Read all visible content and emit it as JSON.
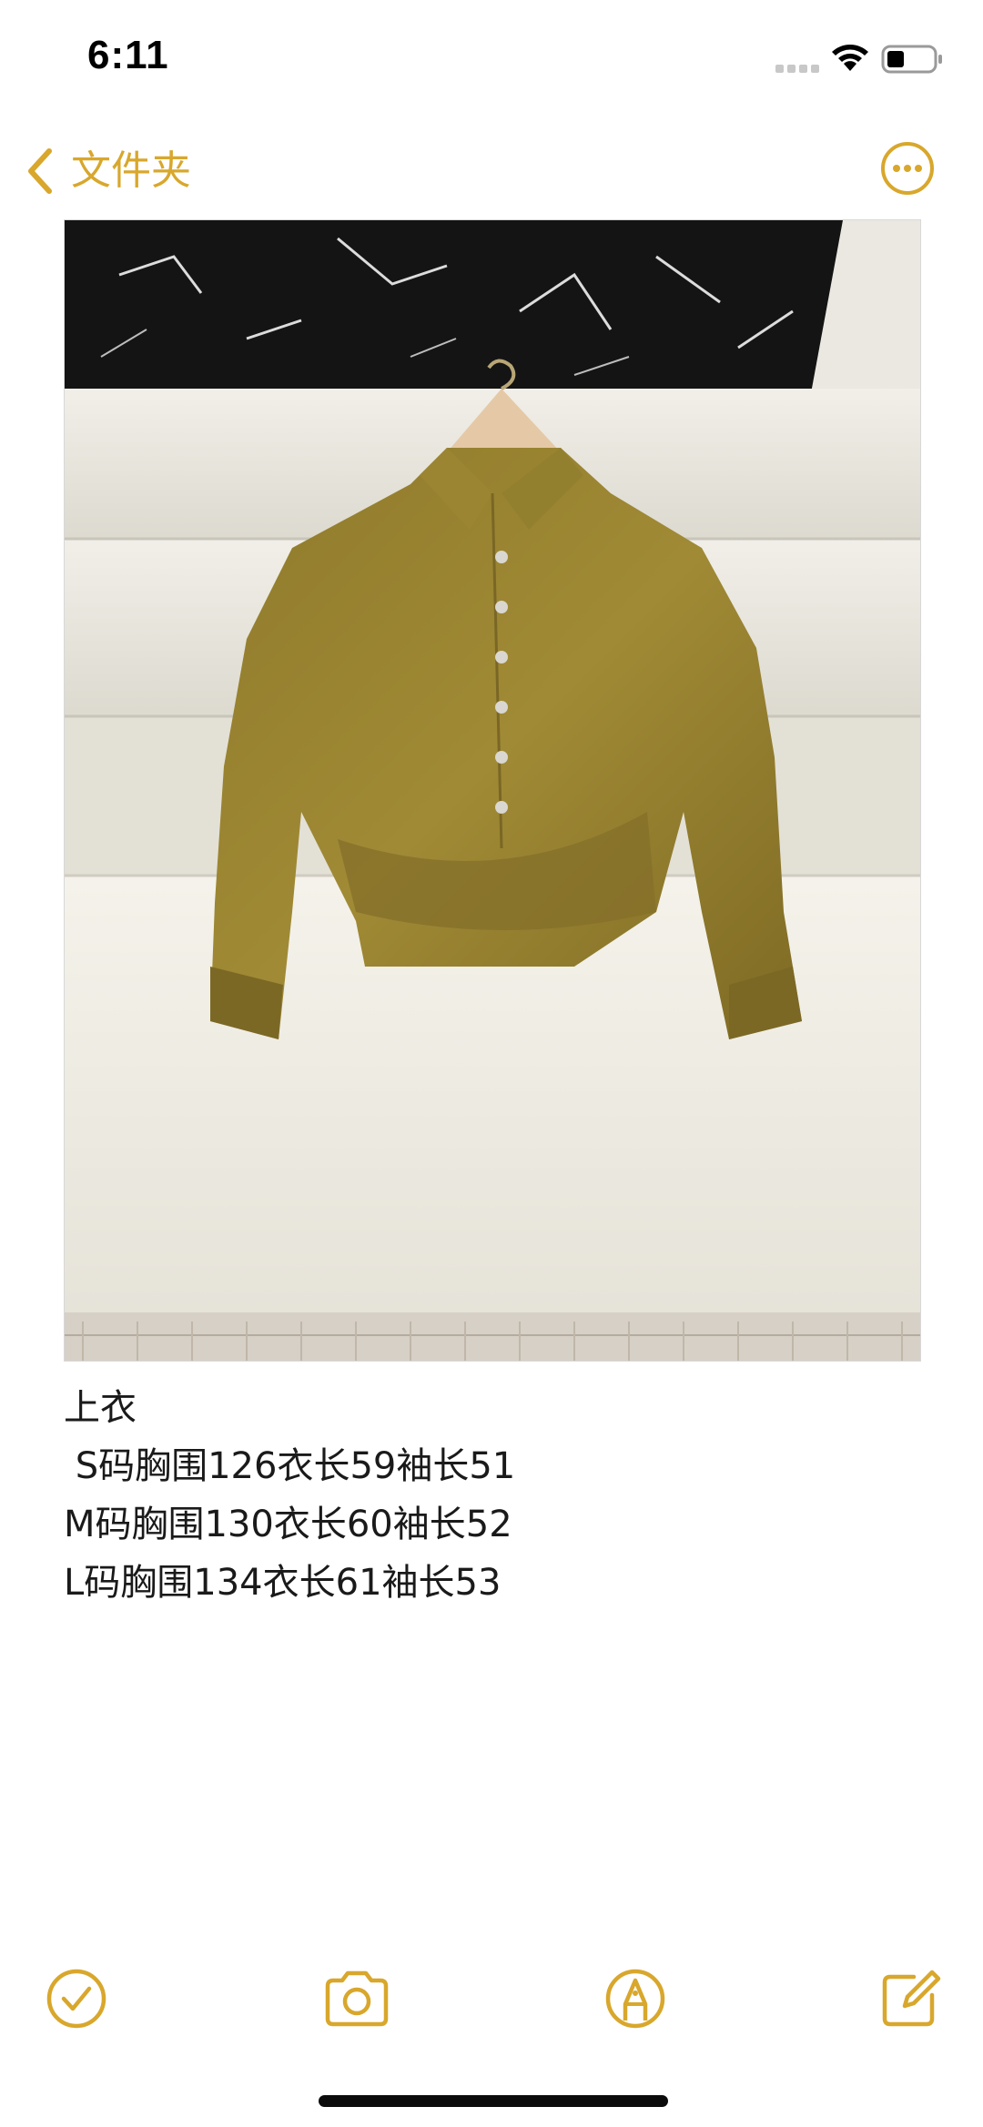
{
  "status_bar": {
    "time": "6:11",
    "signal_icon": "cellular-signal-icon",
    "wifi_icon": "wifi-icon",
    "battery_icon": "battery-icon"
  },
  "nav": {
    "back_icon": "chevron-left-icon",
    "back_label": "文件夹",
    "more_icon": "ellipsis-circle-icon"
  },
  "accent_color": "#d8a72c",
  "note": {
    "image": {
      "description_icon": "photo-attachment",
      "subject": "shirt"
    },
    "lines": [
      "上衣",
      " S码胸围126衣长59袖长51",
      "M码胸围130衣长60袖长52",
      "L码胸围134衣长61袖长53"
    ]
  },
  "toolbar": {
    "items": [
      {
        "icon": "checklist-icon"
      },
      {
        "icon": "camera-icon"
      },
      {
        "icon": "markup-pen-icon"
      },
      {
        "icon": "compose-icon"
      }
    ]
  }
}
